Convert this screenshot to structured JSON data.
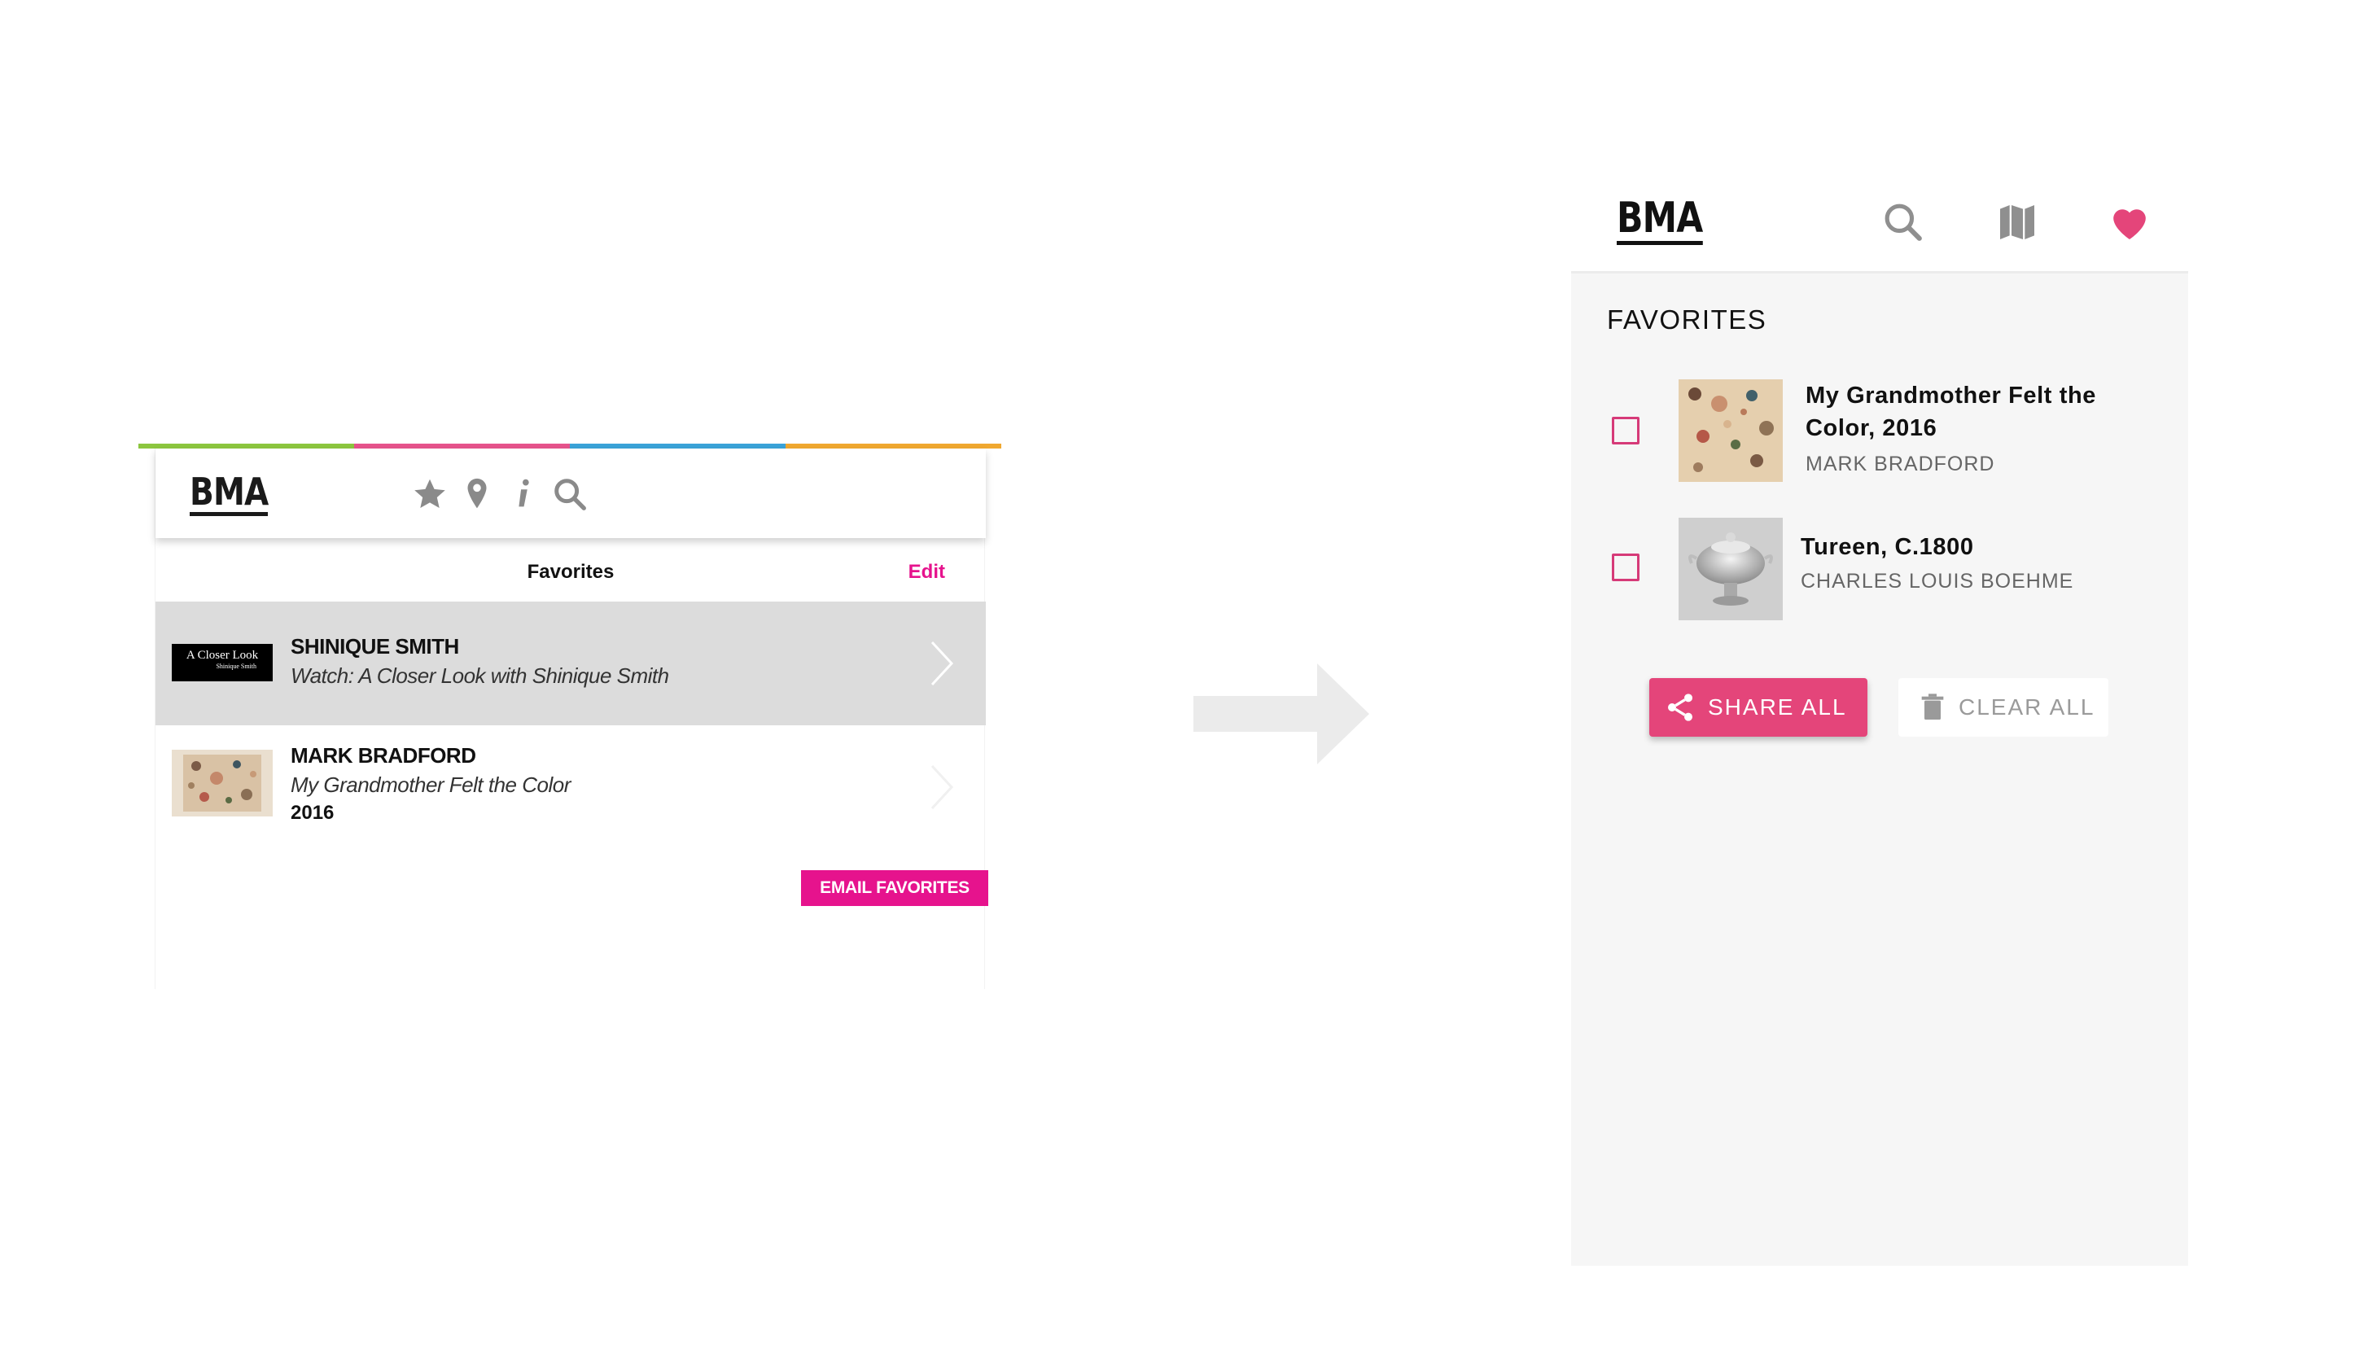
{
  "old_app": {
    "logo": "BMA",
    "stripe_colors": [
      "#8cc63f",
      "#e6538c",
      "#3aa3d8",
      "#f0a830"
    ],
    "header_icons": [
      "star-icon",
      "map-pin-icon",
      "info-icon",
      "search-icon"
    ],
    "title": "Favorites",
    "edit_label": "Edit",
    "items": [
      {
        "artist": "SHINIQUE SMITH",
        "subtitle": "Watch: A Closer Look with Shinique Smith",
        "thumb_text": "A Closer Look",
        "thumb_subtext": "Shinique Smith",
        "selected": true
      },
      {
        "artist": "MARK BRADFORD",
        "subtitle": "My Grandmother Felt the Color",
        "year": "2016",
        "selected": false
      }
    ],
    "email_button": "EMAIL FAVORITES",
    "accent_color": "#e6138d"
  },
  "new_app": {
    "logo": "BMA",
    "nav_icons": [
      "search-icon",
      "map-icon",
      "heart-icon"
    ],
    "heading": "FAVORITES",
    "items": [
      {
        "title_line1": "My Grandmother Felt the",
        "title_line2": "Color, 2016",
        "artist": "MARK BRADFORD",
        "checked": false
      },
      {
        "title_line1": "Tureen, C.1800",
        "artist": "CHARLES LOUIS BOEHME",
        "checked": false
      }
    ],
    "share_button": "SHARE ALL",
    "clear_button": "CLEAR ALL",
    "accent_color": "#e4457a"
  }
}
